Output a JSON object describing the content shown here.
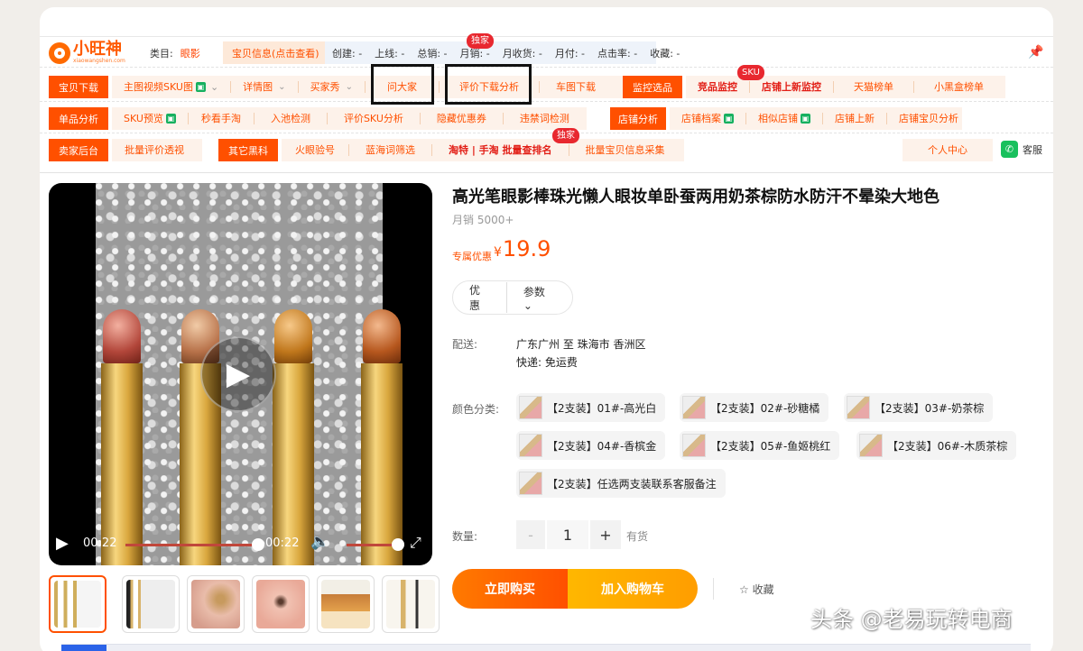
{
  "plugin": {
    "brand": "小旺神",
    "domain": "xiaowangshen.com",
    "category_label": "类目:",
    "category_value": "眼影",
    "info_button": "宝贝信息(点击查看)",
    "stats": [
      "创建: -",
      "上线: -",
      "总销: -",
      "月销: -",
      "月收货: -",
      "月付: -",
      "点击率: -",
      "收藏: -"
    ],
    "exclusive_badge": "独家",
    "sku_badge": "SKU",
    "row1": {
      "main_button": "宝贝下载",
      "links": [
        "主图视频SKU图",
        "详情图",
        "买家秀",
        "问大家",
        "评价下载分析",
        "车图下载"
      ],
      "monitor_button": "监控选品",
      "monitor_links": [
        "竞品监控",
        "店铺上新监控",
        "天猫榜单",
        "小黑盒榜单"
      ]
    },
    "row2": {
      "main_button": "单品分析",
      "links": [
        "SKU预览",
        "秒看手淘",
        "入池检测",
        "评价SKU分析",
        "隐藏优惠券",
        "违禁词检测"
      ],
      "shop_button": "店铺分析",
      "shop_links": [
        "店铺档案",
        "相似店铺",
        "店铺上新",
        "店铺宝贝分析"
      ]
    },
    "row3": {
      "main_button": "卖家后台",
      "links": [
        "批量评价透视"
      ],
      "other_button": "其它黑科",
      "other_links": [
        "火眼验号",
        "蓝海词筛选",
        "淘特 | 手淘 批量查排名",
        "批量宝贝信息采集"
      ],
      "personal": "个人中心",
      "service": "客服"
    }
  },
  "product": {
    "title": "高光笔眼影棒珠光懒人眼妆单卧蚕两用奶茶棕防水防汗不晕染大地色",
    "sales": "月销 5000+",
    "price_label": "专属优惠",
    "currency": "¥",
    "price": "19.9",
    "tabs": [
      "优惠",
      "参数"
    ],
    "shipping_label": "配送:",
    "shipping_route": "广东广州 至 珠海市 香洲区",
    "shipping_fee": "快递: 免运费",
    "color_label": "颜色分类:",
    "skus": [
      "【2支装】01#-高光白",
      "【2支装】02#-砂糖橘",
      "【2支装】03#-奶茶棕",
      "【2支装】04#-香槟金",
      "【2支装】05#-鱼姬桃红",
      "【2支装】06#-木质茶棕",
      "【2支装】任选两支装联系客服备注"
    ],
    "qty_label": "数量:",
    "qty_minus": "-",
    "qty_value": "1",
    "qty_plus": "+",
    "stock": "有货",
    "buy_now": "立即购买",
    "add_cart": "加入购物车",
    "favorite": "☆ 收藏"
  },
  "video": {
    "current_time": "00:22",
    "total_time": "00:22"
  },
  "watermark": "头条 @老易玩转电商"
}
